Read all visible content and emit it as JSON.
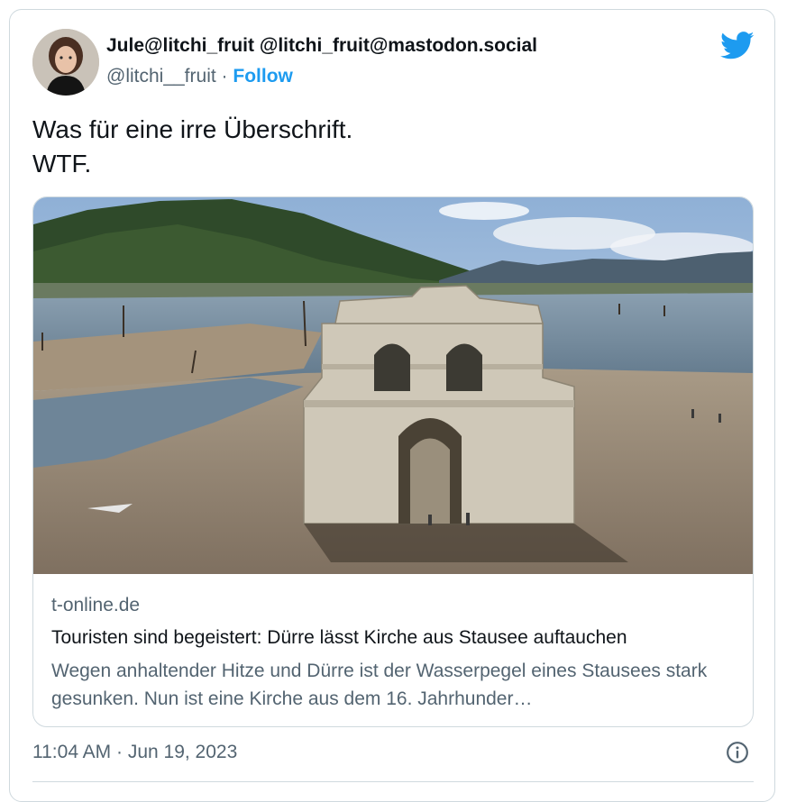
{
  "tweet": {
    "display_name": "Jule@litchi_fruit @litchi_fruit@mastodon.social",
    "handle": "@litchi__fruit",
    "separator": "·",
    "follow_label": "Follow",
    "text_line1": "Was für eine irre Überschrift.",
    "text_line2": "WTF.",
    "timestamp": "11:04 AM · Jun 19, 2023"
  },
  "link_card": {
    "domain": "t-online.de",
    "title": "Touristen sind begeistert: Dürre lässt Kirche aus Stausee auftauchen",
    "description": "Wegen anhaltender Hitze und Dürre ist der Wasserpegel eines Stausees stark gesunken. Nun ist eine Kirche aus dem 16. Jahrhunder…"
  },
  "icons": {
    "brand": "twitter-bird-icon",
    "info": "info-icon"
  },
  "colors": {
    "accent": "#1d9bf0",
    "primary_text": "#0f1419",
    "secondary_text": "#536471",
    "border": "#cfd9de"
  }
}
